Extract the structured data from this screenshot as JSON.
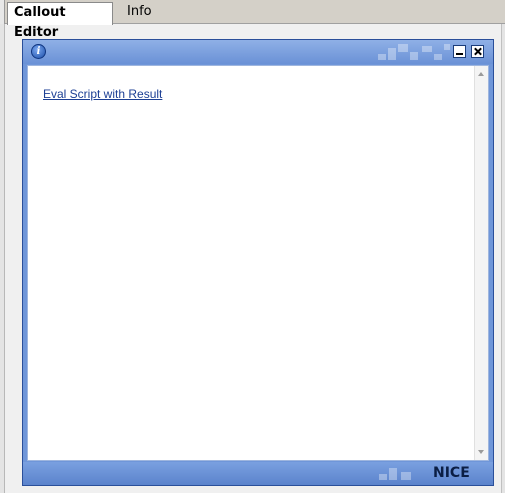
{
  "tabs": [
    {
      "label": "Callout Editor",
      "active": true
    },
    {
      "label": "Info",
      "active": false
    }
  ],
  "panel": {
    "info_icon": "info-icon",
    "link_text": "Eval Script with Result",
    "logo_text": "NICE",
    "colors": {
      "header": "#6a91d6",
      "border": "#2a4f9a",
      "link": "#1c3f94"
    }
  }
}
